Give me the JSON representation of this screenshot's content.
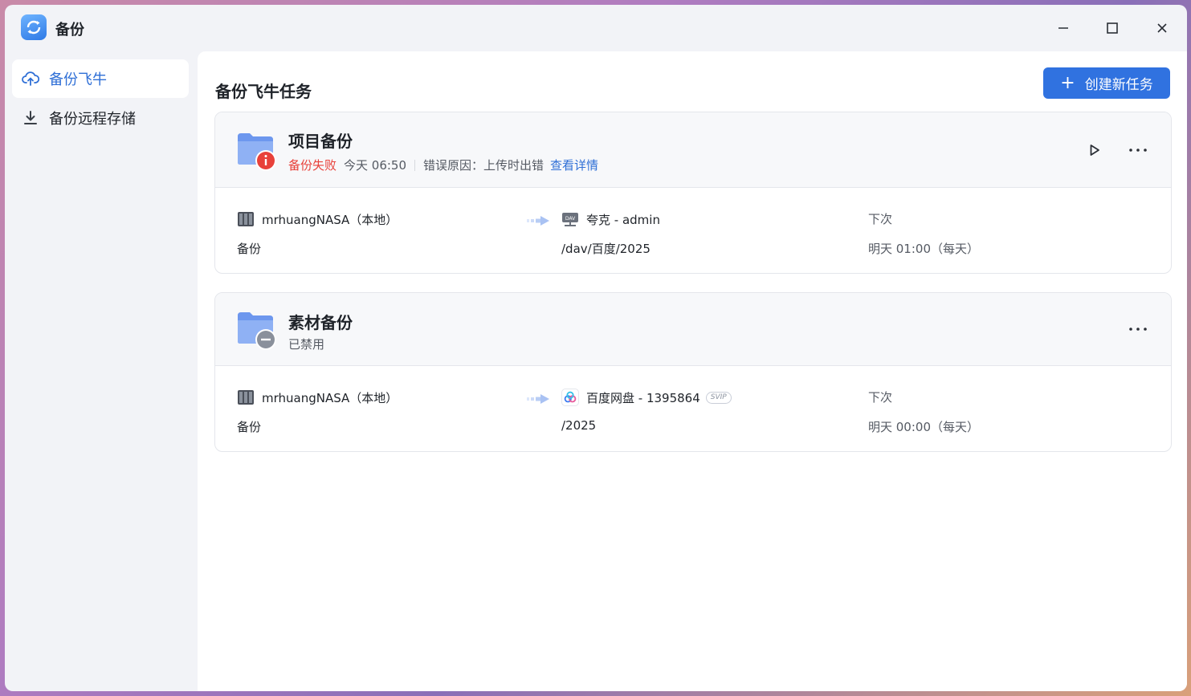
{
  "window": {
    "title": "备份"
  },
  "sidebar": {
    "items": [
      {
        "label": "备份飞牛",
        "icon": "cloud-upload-icon",
        "active": true
      },
      {
        "label": "备份远程存储",
        "icon": "download-icon",
        "active": false
      }
    ]
  },
  "main": {
    "title": "备份飞牛任务",
    "create_button": "创建新任务"
  },
  "tasks": [
    {
      "name": "项目备份",
      "status": "备份失败",
      "time": "今天 06:50",
      "error": "错误原因：上传时出错",
      "detail_link": "查看详情",
      "source_device": "mrhuangNASA（本地）",
      "source_path": "备份",
      "target": "夸克 - admin",
      "target_path": "/dav/百度/2025",
      "next_label": "下次",
      "next_time": "明天 01:00（每天）",
      "colors": {
        "status": "#e8413a"
      }
    },
    {
      "name": "素材备份",
      "status": "已禁用",
      "source_device": "mrhuangNASA（本地）",
      "source_path": "备份",
      "target": "百度网盘 - 1395864",
      "target_badge": "SVIP",
      "target_path": "/2025",
      "next_label": "下次",
      "next_time": "明天 00:00（每天）"
    }
  ],
  "colors": {
    "accent": "#3072e0",
    "link": "#2f6fd6",
    "error": "#e8413a"
  }
}
